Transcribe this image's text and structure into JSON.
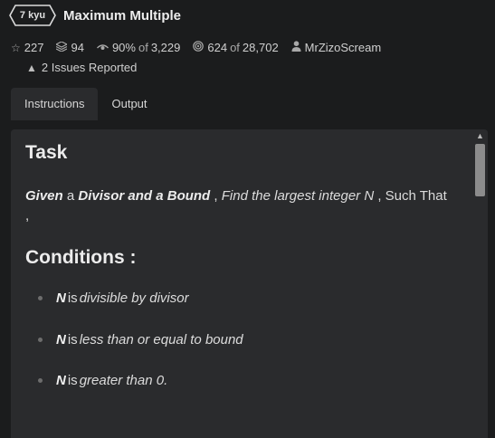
{
  "kata": {
    "rank": "7 kyu",
    "title": "Maximum Multiple"
  },
  "stats": {
    "stars": "227",
    "collections": "94",
    "satisfaction": "90%",
    "satisfaction_of": "of",
    "satisfaction_votes": "3,229",
    "completed": "624",
    "completed_of": "of",
    "attempts": "28,702",
    "author": "MrZizoScream"
  },
  "issues": {
    "label": "2 Issues Reported"
  },
  "tabs": [
    {
      "label": "Instructions",
      "active": true
    },
    {
      "label": "Output",
      "active": false
    }
  ],
  "instructions": {
    "task_heading": "Task",
    "given_bold_1": "Given",
    "given_plain_1": " a ",
    "given_bold_2": "Divisor and a Bound",
    "given_plain_2": " , ",
    "given_italic_1": "Find the largest integer N",
    "given_plain_3": " , Such That",
    "given_plain_4": " ,",
    "conditions_heading": "Conditions :",
    "conditions": [
      {
        "bold": "N",
        "plain": " is ",
        "italic": "divisible by divisor"
      },
      {
        "bold": "N",
        "plain": " is ",
        "italic": "less than or equal to bound"
      },
      {
        "bold": "N",
        "plain": " is ",
        "italic": "greater than 0."
      }
    ]
  },
  "icons": {
    "kyu_badge": "hexagon-badge",
    "stars": "star-icon",
    "collections": "stack-icon",
    "satisfaction": "eye-icon",
    "completed": "target-icon",
    "author": "user-icon",
    "issues": "warning-icon",
    "scroll_up": "chevron-up-icon"
  },
  "colors": {
    "background": "#1b1c1d",
    "panel": "#2a2b2d",
    "text": "#d6d6d6"
  }
}
